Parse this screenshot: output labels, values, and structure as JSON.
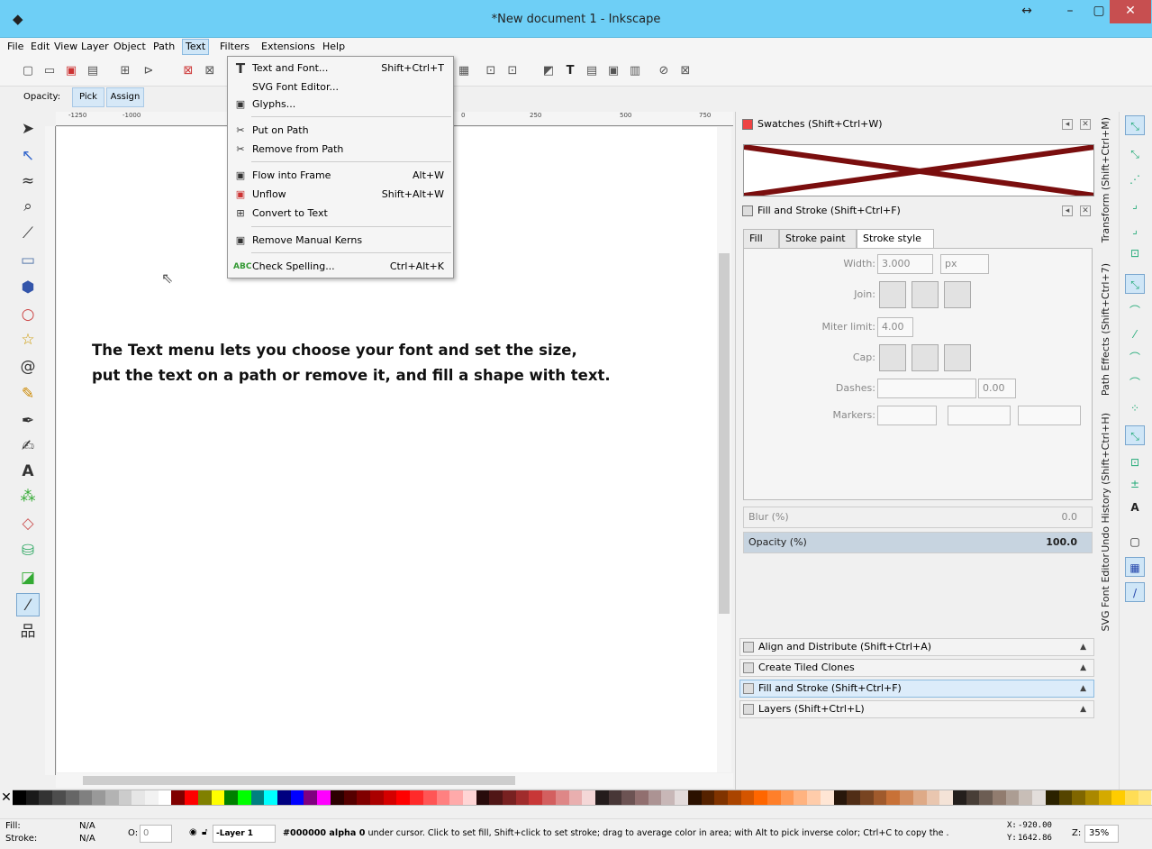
{
  "window": {
    "title": "*New document 1 - Inkscape"
  },
  "menubar": {
    "items": [
      "File",
      "Edit",
      "View",
      "Layer",
      "Object",
      "Path",
      "Text",
      "Filters",
      "Extensions",
      "Help"
    ]
  },
  "ctrlbar": {
    "opacity_label": "Opacity:",
    "pick": "Pick",
    "assign": "Assign"
  },
  "ruler": {
    "ticks": [
      "-1250",
      "-1000",
      "0",
      "250",
      "500",
      "750"
    ]
  },
  "canvas": {
    "line1": "The Text menu lets you choose your font and set the size,",
    "line2": "put the text on a path or remove it, and fill a shape with text."
  },
  "textmenu": {
    "items": [
      {
        "icon": "text-font-icon",
        "label": "Text and Font...",
        "shortcut": "Shift+Ctrl+T"
      },
      {
        "icon": "",
        "label": "SVG Font Editor...",
        "shortcut": ""
      },
      {
        "icon": "glyphs-icon",
        "label": "Glyphs...",
        "shortcut": ""
      },
      {
        "icon": "put-on-path-icon",
        "label": "Put on Path",
        "shortcut": ""
      },
      {
        "icon": "remove-from-path-icon",
        "label": "Remove from Path",
        "shortcut": ""
      },
      {
        "icon": "flow-frame-icon",
        "label": "Flow into Frame",
        "shortcut": "Alt+W"
      },
      {
        "icon": "unflow-icon",
        "label": "Unflow",
        "shortcut": "Shift+Alt+W"
      },
      {
        "icon": "convert-text-icon",
        "label": "Convert to Text",
        "shortcut": ""
      },
      {
        "icon": "remove-kerns-icon",
        "label": "Remove Manual Kerns",
        "shortcut": ""
      },
      {
        "icon": "spellcheck-icon",
        "label": "Check Spelling...",
        "shortcut": "Ctrl+Alt+K"
      }
    ]
  },
  "dock": {
    "swatches_title": "Swatches (Shift+Ctrl+W)",
    "fill_stroke_title": "Fill and Stroke (Shift+Ctrl+F)",
    "tabs": [
      "Fill",
      "Stroke paint",
      "Stroke style"
    ],
    "width_label": "Width:",
    "width_value": "3.000",
    "width_unit": "px",
    "join_label": "Join:",
    "miter_label": "Miter limit:",
    "miter_value": "4.00",
    "cap_label": "Cap:",
    "dashes_label": "Dashes:",
    "dashes_value": "0.00",
    "markers_label": "Markers:",
    "blur_label": "Blur (%)",
    "blur_value": "0.0",
    "opacity_label": "Opacity (%)",
    "opacity_value": "100.0",
    "collapsed": [
      "Align and Distribute (Shift+Ctrl+A)",
      "Create Tiled Clones",
      "Fill and Stroke (Shift+Ctrl+F)",
      "Layers (Shift+Ctrl+L)"
    ]
  },
  "vtabs": [
    "Transform (Shift+Ctrl+M)",
    "Path Effects (Shift+Ctrl+7)",
    "Undo History (Shift+Ctrl+H)",
    "SVG Font Editor"
  ],
  "palette": {
    "colors": [
      "#000000",
      "#1a1a1a",
      "#333333",
      "#4d4d4d",
      "#666666",
      "#808080",
      "#999999",
      "#b3b3b3",
      "#cccccc",
      "#e6e6e6",
      "#f2f2f2",
      "#ffffff",
      "#800000",
      "#ff0000",
      "#808000",
      "#ffff00",
      "#008000",
      "#00ff00",
      "#008080",
      "#00ffff",
      "#000080",
      "#0000ff",
      "#800080",
      "#ff00ff",
      "#2b0000",
      "#550000",
      "#800000",
      "#aa0000",
      "#d40000",
      "#ff0000",
      "#ff2a2a",
      "#ff5555",
      "#ff8080",
      "#ffaaaa",
      "#ffd5d5",
      "#280b0b",
      "#501616",
      "#782121",
      "#a02c2c",
      "#c83737",
      "#d35f5f",
      "#de8787",
      "#e9afaf",
      "#f4d7d7",
      "#241c1c",
      "#483737",
      "#6c5353",
      "#916f6f",
      "#ac9393",
      "#c8b7b7",
      "#e3dbdb",
      "#2b1100",
      "#552200",
      "#803300",
      "#aa4400",
      "#d45500",
      "#ff6600",
      "#ff7f2a",
      "#ff9955",
      "#ffb380",
      "#ffccaa",
      "#ffe6d5",
      "#28170b",
      "#502d16",
      "#784421",
      "#a05a2c",
      "#c87137",
      "#d38d5f",
      "#deaa87",
      "#e9c6af",
      "#f4e3d7",
      "#241f1c",
      "#483e37",
      "#6c5d53",
      "#917c6f",
      "#ac9d93",
      "#c8beb7",
      "#e3dedb",
      "#2b2200",
      "#554400",
      "#806600",
      "#aa8800",
      "#d4aa00",
      "#ffcc00",
      "#ffdd55",
      "#ffe680"
    ]
  },
  "status": {
    "fill_label": "Fill:",
    "fill_value": "N/A",
    "stroke_label": "Stroke:",
    "stroke_value": "N/A",
    "o_label": "O:",
    "o_value": "0",
    "layer": "-Layer 1",
    "message_bold1": "#000000 alpha 0",
    "message_rest": " under cursor. Click to set fill, Shift+click to set stroke; drag to average color in area; with Alt to pick inverse color; Ctrl+C to copy the .",
    "x_label": "X:",
    "x_value": "-920.00",
    "y_label": "Y:",
    "y_value": "1642.86",
    "z_label": "Z:",
    "zoom": "35%"
  }
}
